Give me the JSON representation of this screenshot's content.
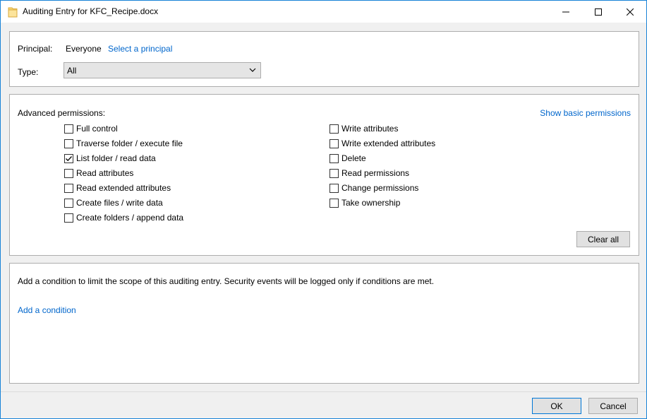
{
  "window": {
    "title": "Auditing Entry for KFC_Recipe.docx"
  },
  "principal": {
    "label": "Principal:",
    "value": "Everyone",
    "select_link": "Select a principal"
  },
  "type": {
    "label": "Type:",
    "selected": "All"
  },
  "permissions": {
    "heading": "Advanced permissions:",
    "show_basic_link": "Show basic permissions",
    "left": [
      {
        "label": "Full control",
        "checked": false
      },
      {
        "label": "Traverse folder / execute file",
        "checked": false
      },
      {
        "label": "List folder / read data",
        "checked": true
      },
      {
        "label": "Read attributes",
        "checked": false
      },
      {
        "label": "Read extended attributes",
        "checked": false
      },
      {
        "label": "Create files / write data",
        "checked": false
      },
      {
        "label": "Create folders / append data",
        "checked": false
      }
    ],
    "right": [
      {
        "label": "Write attributes",
        "checked": false
      },
      {
        "label": "Write extended attributes",
        "checked": false
      },
      {
        "label": "Delete",
        "checked": false
      },
      {
        "label": "Read permissions",
        "checked": false
      },
      {
        "label": "Change permissions",
        "checked": false
      },
      {
        "label": "Take ownership",
        "checked": false
      }
    ],
    "clear_all": "Clear all"
  },
  "condition": {
    "description": "Add a condition to limit the scope of this auditing entry. Security events will be logged only if conditions are met.",
    "add_link": "Add a condition"
  },
  "footer": {
    "ok": "OK",
    "cancel": "Cancel"
  }
}
